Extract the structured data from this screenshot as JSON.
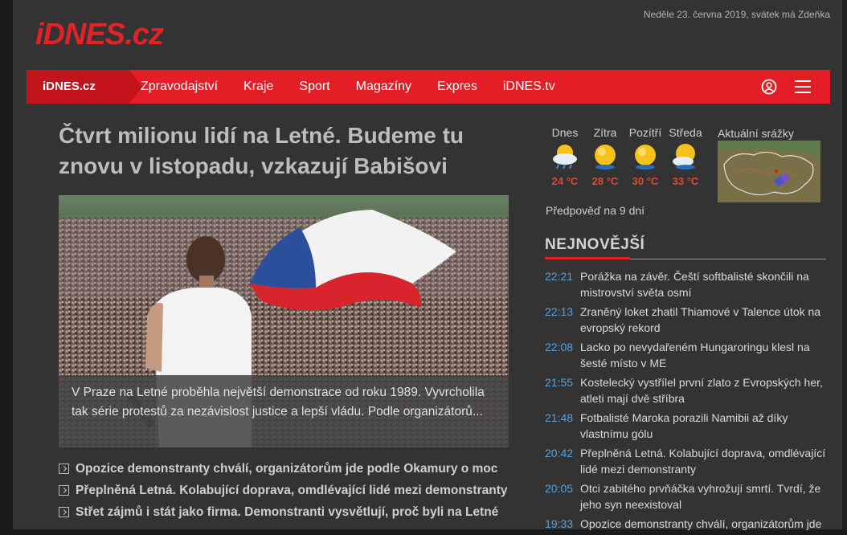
{
  "header": {
    "logo_text": "iDNES.cz",
    "dateline": "Neděle 23. června 2019, svátek má Zdeňka"
  },
  "nav": {
    "home": "iDNES.cz",
    "items": [
      "Zpravodajství",
      "Kraje",
      "Sport",
      "Magazíny",
      "Expres",
      "iDNES.tv"
    ],
    "user_icon": "user-icon",
    "menu_icon": "hamburger-menu-icon"
  },
  "main": {
    "headline": "Čtvrt milionu lidí na Letné. Budeme tu znovu v listopadu, vzkazují Babišovi",
    "caption": "V Praze na Letné proběhla největší demonstrace od roku 1989. Vyvrcholila tak série protestů za nezávislost justice a lepší vládu. Podle organizátorů...",
    "related": [
      "Opozice demonstranty chválí, organizátorům jde podle Okamury o moc",
      "Přeplněná Letná. Kolabující doprava, omdlévající lidé mezi demonstranty",
      "Střet zájmů i stát jako firma. Demonstranti vysvětlují, proč byli na Letné"
    ]
  },
  "weather": {
    "days": [
      {
        "label": "Dnes",
        "temp": "24 °C",
        "icon": "sun-cloud-rain-icon"
      },
      {
        "label": "Zítra",
        "temp": "28 °C",
        "icon": "sun-icon"
      },
      {
        "label": "Pozítří",
        "temp": "30 °C",
        "icon": "sun-icon"
      },
      {
        "label": "Středa",
        "temp": "33 °C",
        "icon": "sun-cloud-icon"
      }
    ],
    "forecast_link": "Předpověď na 9 dní",
    "radar_label": "Aktuální srážky"
  },
  "latest": {
    "title": "NEJNOVĚJŠÍ",
    "items": [
      {
        "time": "22:21",
        "text": "Porážka na závěr. Čeští softbalisté skončili na mistrovství světa osmí"
      },
      {
        "time": "22:13",
        "text": "Zraněný loket zhatil Thiamové v Talence útok na evropský rekord"
      },
      {
        "time": "22:08",
        "text": "Lacko po nevydařeném Hungaroringu klesl na šesté místo v ME"
      },
      {
        "time": "21:55",
        "text": "Kostelecký vystřílel první zlato z Evropských her, atleti mají dvě stříbra"
      },
      {
        "time": "21:48",
        "text": "Fotbalisté Maroka porazili Namibii až díky vlastnímu gólu"
      },
      {
        "time": "20:42",
        "text": "Přeplněná Letná. Kolabující doprava, omdlévající lidé mezi demonstranty"
      },
      {
        "time": "20:05",
        "text": "Otci zabitého prvňáčka vyhrožují smrtí. Tvrdí, že jeho syn neexistoval"
      },
      {
        "time": "19:33",
        "text": "Opozice demonstranty chválí, organizátorům jde"
      }
    ]
  },
  "colors": {
    "brand_red": "#e41e26",
    "time_blue": "#5aa0d8",
    "temp_red": "#e8452c"
  }
}
